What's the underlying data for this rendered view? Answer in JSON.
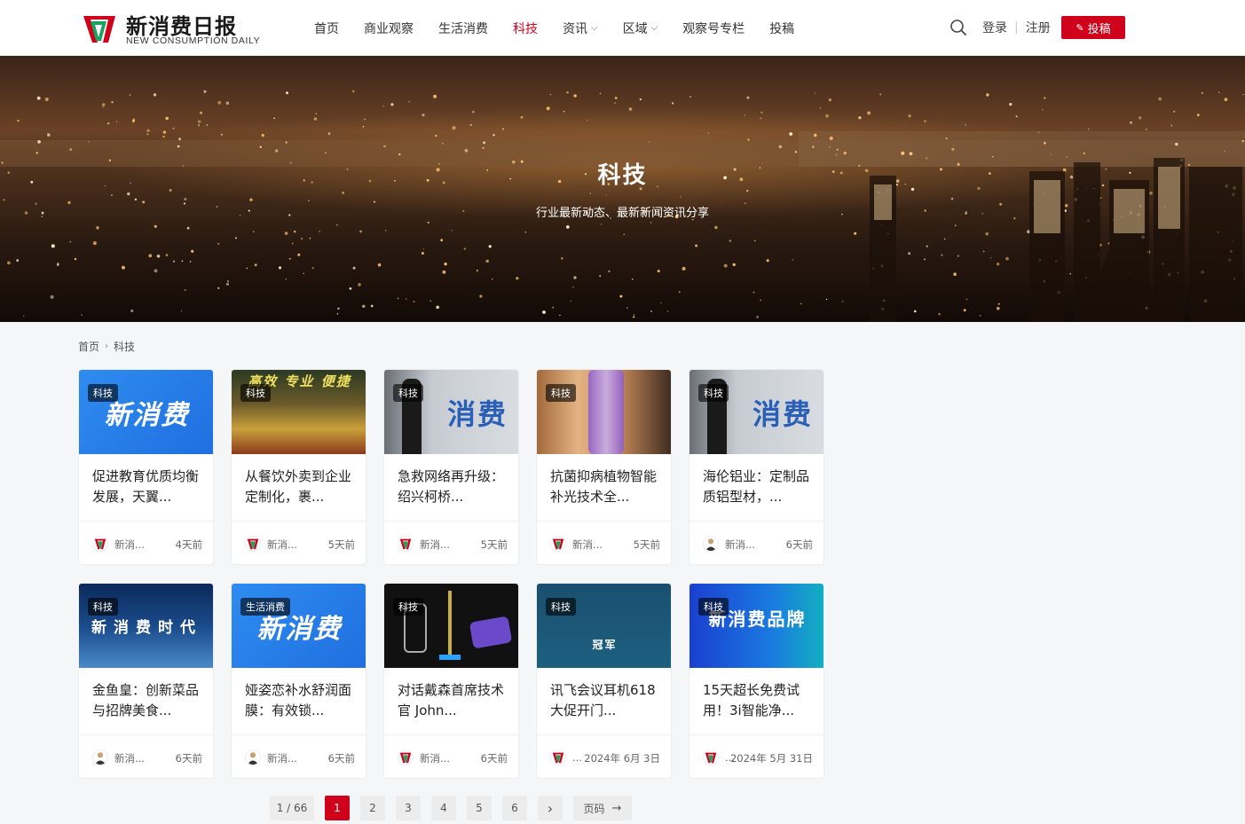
{
  "header": {
    "logo_cn": "新消费日报",
    "logo_en": "NEW CONSUMPTION DAILY",
    "nav": [
      {
        "label": "首页",
        "active": false,
        "dropdown": false
      },
      {
        "label": "商业观察",
        "active": false,
        "dropdown": false
      },
      {
        "label": "生活消费",
        "active": false,
        "dropdown": false
      },
      {
        "label": "科技",
        "active": true,
        "dropdown": false
      },
      {
        "label": "资讯",
        "active": false,
        "dropdown": true
      },
      {
        "label": "区域",
        "active": false,
        "dropdown": true
      },
      {
        "label": "观察号专栏",
        "active": false,
        "dropdown": false
      },
      {
        "label": "投稿",
        "active": false,
        "dropdown": false
      }
    ],
    "login": "登录",
    "register": "注册",
    "submit": "投稿"
  },
  "banner": {
    "title": "科技",
    "subtitle": "行业最新动态、最新新闻资讯分享"
  },
  "breadcrumb": {
    "home": "首页",
    "current": "科技"
  },
  "cards": [
    {
      "tag": "科技",
      "thumb_text": "新消费",
      "title": "促进教育优质均衡发展，天翼...",
      "author": "新消...",
      "time": "4天前",
      "avatar": "logo",
      "thumb": "blue"
    },
    {
      "tag": "科技",
      "thumb_text": "高效 专业 便捷",
      "title": "从餐饮外卖到企业定制化，裹...",
      "author": "新消...",
      "time": "5天前",
      "avatar": "logo",
      "thumb": "market"
    },
    {
      "tag": "科技",
      "thumb_text": "消费",
      "title": "急救网络再升级：绍兴柯桥...",
      "author": "新消...",
      "time": "5天前",
      "avatar": "logo",
      "thumb": "grey"
    },
    {
      "tag": "科技",
      "thumb_text": "",
      "title": "抗菌抑病植物智能补光技术全...",
      "author": "新消...",
      "time": "5天前",
      "avatar": "logo",
      "thumb": "lamp"
    },
    {
      "tag": "科技",
      "thumb_text": "消费",
      "title": "海伦铝业：定制品质铝型材，...",
      "author": "新消...",
      "time": "6天前",
      "avatar": "person",
      "thumb": "grey"
    },
    {
      "tag": "科技",
      "thumb_text": "新消费时代",
      "title": "金鱼皇：创新菜品与招牌美食...",
      "author": "新消...",
      "time": "6天前",
      "avatar": "person",
      "thumb": "city"
    },
    {
      "tag": "生活消费",
      "thumb_text": "新消费",
      "title": "娅姿恋补水舒润面膜：有效锁...",
      "author": "新消...",
      "time": "6天前",
      "avatar": "person",
      "thumb": "blue"
    },
    {
      "tag": "科技",
      "thumb_text": "",
      "title": "对话戴森首席技术官 John...",
      "author": "新消...",
      "time": "6天前",
      "avatar": "logo",
      "thumb": "dyson"
    },
    {
      "tag": "科技",
      "thumb_text": "冠军",
      "title": "讯飞会议耳机618大促开门...",
      "author": "...",
      "time": "2024年 6月 3日",
      "avatar": "logo",
      "thumb": "teal"
    },
    {
      "tag": "科技",
      "thumb_text": "新消费品牌",
      "title": "15天超长免费试用！3i智能净...",
      "author": "...",
      "time": "2024年 5月 31日",
      "avatar": "logo",
      "thumb": "brand"
    }
  ],
  "pagination": {
    "info": "1 / 66",
    "pages": [
      "1",
      "2",
      "3",
      "4",
      "5",
      "6"
    ],
    "current": "1",
    "next": "›",
    "jump_label": "页码"
  },
  "colors": {
    "accent": "#d0021b",
    "logo_green": "#1aa260"
  }
}
